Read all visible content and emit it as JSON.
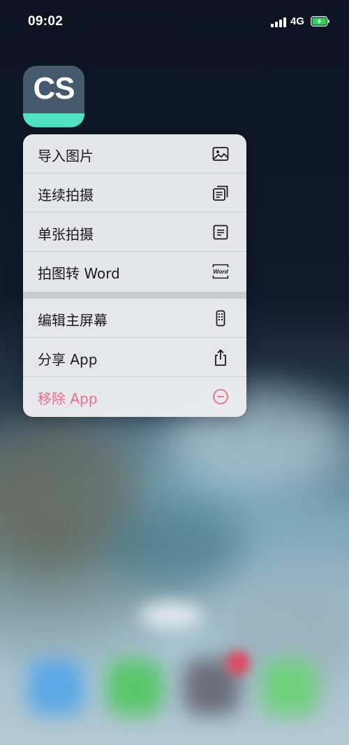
{
  "status_bar": {
    "time": "09:02",
    "network": "4G",
    "signal_icon": "cellular-signal-icon",
    "battery_icon": "battery-charging-icon",
    "battery_color": "#30d158"
  },
  "app": {
    "icon_text": "CS",
    "icon_colors": {
      "background": "#465a6e",
      "band": "#4fe3c1"
    }
  },
  "menu": {
    "items": [
      {
        "label": "导入图片",
        "icon": "image-icon"
      },
      {
        "label": "连续拍摄",
        "icon": "stacked-documents-icon"
      },
      {
        "label": "单张拍摄",
        "icon": "single-document-icon"
      },
      {
        "label": "拍图转 Word",
        "icon": "word-document-icon",
        "icon_text": "Word"
      }
    ],
    "system_items": [
      {
        "label": "编辑主屏幕",
        "icon": "phone-grid-icon"
      },
      {
        "label": "分享 App",
        "icon": "share-icon"
      },
      {
        "label": "移除 App",
        "icon": "minus-circle-icon",
        "color": "#ee6e8a"
      }
    ]
  },
  "dock": {
    "apps": [
      {
        "icon": "safari-icon",
        "color": "#5aa8e6"
      },
      {
        "icon": "phone-icon",
        "color": "#58c66a"
      },
      {
        "icon": "app-icon",
        "color": "#6b6e79"
      },
      {
        "icon": "messages-icon",
        "color": "#6fd07d"
      }
    ]
  }
}
